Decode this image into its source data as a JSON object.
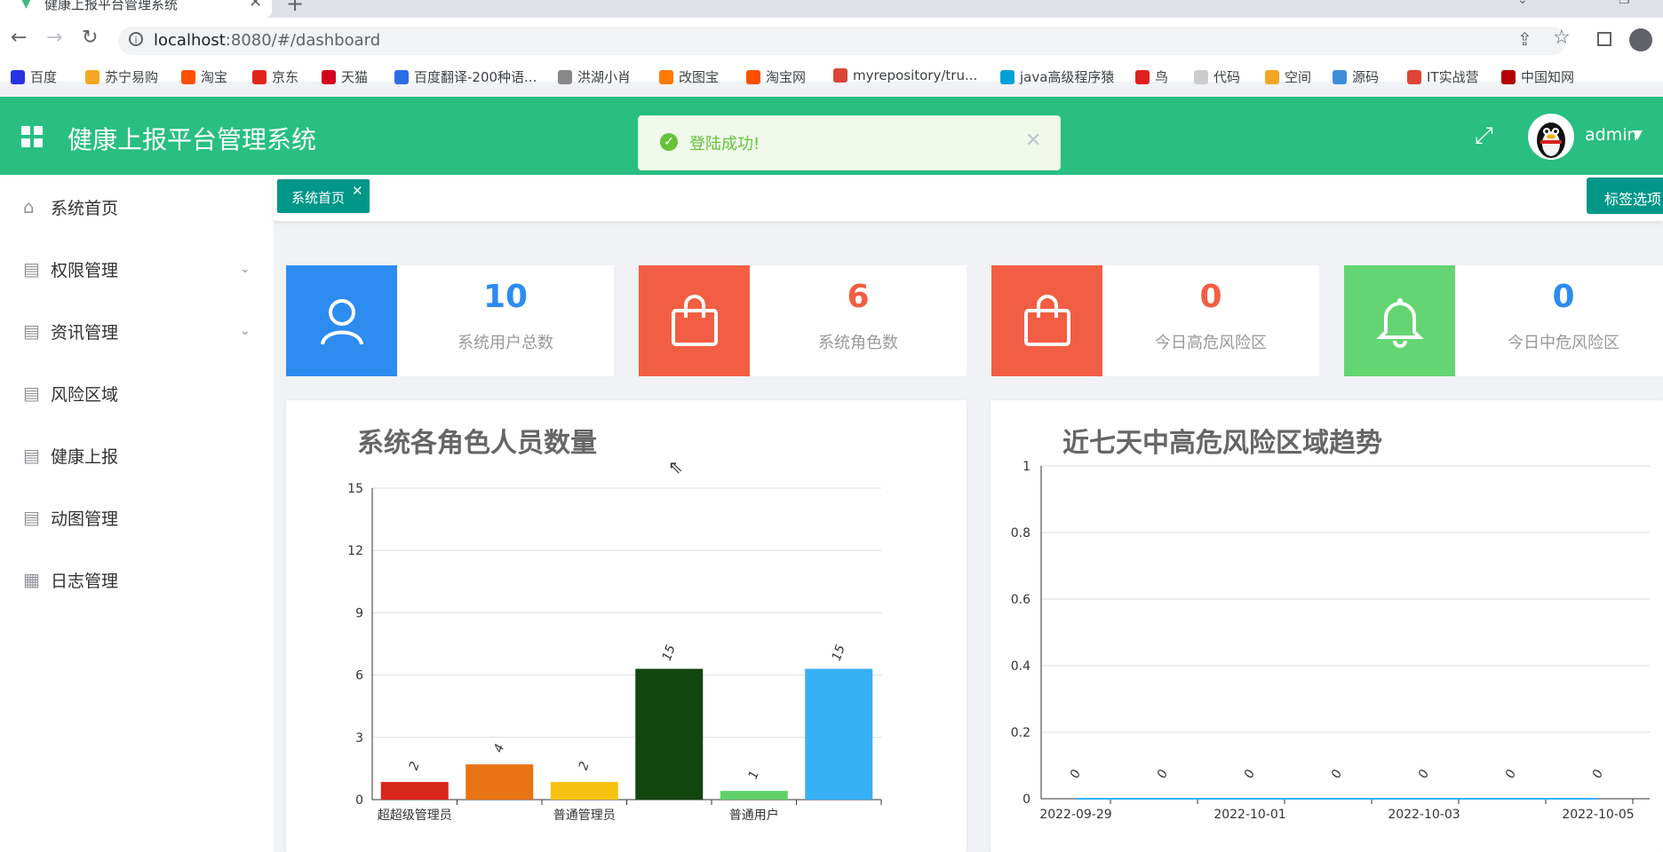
{
  "browser": {
    "tab_title": "健康上报平台管理系统",
    "url_host": "localhost",
    "url_rest": ":8080/#/dashboard",
    "bookmarks": [
      {
        "label": "百度",
        "color": "#2932e1"
      },
      {
        "label": "苏宁易购",
        "color": "#f5a623"
      },
      {
        "label": "淘宝",
        "color": "#ff5000"
      },
      {
        "label": "京东",
        "color": "#e1251b"
      },
      {
        "label": "天猫",
        "color": "#d4001d"
      },
      {
        "label": "百度翻译-200种语...",
        "color": "#2b6de5"
      },
      {
        "label": "洪湖小肖",
        "color": "#888888"
      },
      {
        "label": "改图宝",
        "color": "#ff7a00"
      },
      {
        "label": "淘宝网",
        "color": "#ff5000"
      },
      {
        "label": "myrepository/tru...",
        "color": "#db4437"
      },
      {
        "label": "java高级程序猿",
        "color": "#00a1d6"
      },
      {
        "label": "鸟",
        "color": "#e02020"
      },
      {
        "label": "代码",
        "color": "#cccccc"
      },
      {
        "label": "空间",
        "color": "#f5a623"
      },
      {
        "label": "源码",
        "color": "#3b8fd8"
      },
      {
        "label": "IT实战营",
        "color": "#db4437"
      },
      {
        "label": "中国知网",
        "color": "#b30000"
      }
    ]
  },
  "header": {
    "title": "健康上报平台管理系统",
    "user": "admin",
    "bg_color": "#28bf80"
  },
  "toast": {
    "message": "登陆成功!"
  },
  "sidebar": {
    "items": [
      {
        "label": "系统首页",
        "icon": "home-icon",
        "has_caret": false
      },
      {
        "label": "权限管理",
        "icon": "document-icon",
        "has_caret": true
      },
      {
        "label": "资讯管理",
        "icon": "document-icon",
        "has_caret": true
      },
      {
        "label": "风险区域",
        "icon": "document-icon",
        "has_caret": false
      },
      {
        "label": "健康上报",
        "icon": "document-icon",
        "has_caret": false
      },
      {
        "label": "动图管理",
        "icon": "document-icon",
        "has_caret": false
      },
      {
        "label": "日志管理",
        "icon": "calendar-icon",
        "has_caret": false
      }
    ]
  },
  "tags": {
    "home_label": "系统首页",
    "options_label": "标签选项"
  },
  "stats": [
    {
      "value": "10",
      "label": "系统用户总数",
      "color": "#2d8cf0",
      "icon": "user-icon",
      "num_color": "#2d8cf0"
    },
    {
      "value": "6",
      "label": "系统角色数",
      "color": "#f25e43",
      "icon": "shopping-bag-icon",
      "num_color": "#f25e43"
    },
    {
      "value": "0",
      "label": "今日高危风险区",
      "color": "#f25e43",
      "icon": "shopping-bag-icon",
      "num_color": "#f25e43"
    },
    {
      "value": "0",
      "label": "今日中危风险区",
      "color": "#64d572",
      "icon": "bell-icon",
      "num_color": "#2d8cf0"
    }
  ],
  "chart_data": [
    {
      "type": "bar",
      "title": "系统各角色人员数量",
      "categories": [
        "超超级管理员",
        "",
        "普通管理员",
        "",
        "普通用户",
        ""
      ],
      "values": [
        2,
        4,
        2,
        15,
        1,
        15
      ],
      "bar_heights": [
        0.85,
        1.7,
        0.85,
        6.3,
        0.42,
        6.3
      ],
      "colors": [
        "#d9261c",
        "#e87414",
        "#f5c20f",
        "#12460f",
        "#5fd068",
        "#37b0f5"
      ],
      "yticks": [
        0,
        3,
        6,
        9,
        12,
        15
      ],
      "ylim": [
        0,
        15
      ],
      "grid": true
    },
    {
      "type": "line",
      "title": "近七天中高危风险区域趋势",
      "x": [
        "2022-09-29",
        "2022-09-30",
        "2022-10-01",
        "2022-10-02",
        "2022-10-03",
        "2022-10-04",
        "2022-10-05"
      ],
      "xtick_labels": [
        "2022-09-29",
        "2022-10-01",
        "2022-10-03",
        "2022-10-05"
      ],
      "values": [
        0,
        0,
        0,
        0,
        0,
        0,
        0
      ],
      "yticks": [
        0,
        0.2,
        0.4,
        0.6,
        0.8,
        1
      ],
      "ylim": [
        0,
        1
      ],
      "grid": true
    }
  ]
}
